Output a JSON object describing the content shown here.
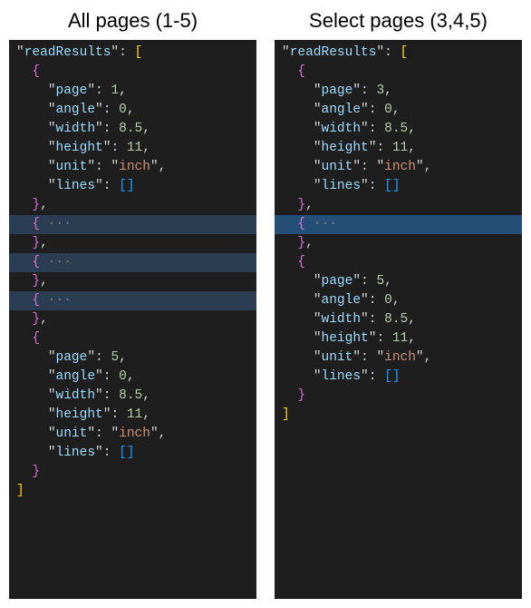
{
  "headings": {
    "left": "All pages (1-5)",
    "right": "Select pages (3,4,5)"
  },
  "json_field": {
    "readResults": "readResults",
    "page": "page",
    "angle": "angle",
    "width": "width",
    "height": "height",
    "unit": "unit",
    "lines": "lines"
  },
  "left_panel": {
    "first_page": {
      "page": "1",
      "angle": "0",
      "width": "8.5",
      "height": "11",
      "unit": "inch"
    },
    "last_page": {
      "page": "5",
      "angle": "0",
      "width": "8.5",
      "height": "11",
      "unit": "inch"
    },
    "folded_count": 3
  },
  "right_panel": {
    "first_page": {
      "page": "3",
      "angle": "0",
      "width": "8.5",
      "height": "11",
      "unit": "inch"
    },
    "last_page": {
      "page": "5",
      "angle": "0",
      "width": "8.5",
      "height": "11",
      "unit": "inch"
    },
    "folded_count": 1
  },
  "punct": {
    "quote": "\"",
    "colon": ":",
    "comma": ",",
    "open_sq": "[",
    "close_sq": "]",
    "open_br": "{",
    "close_br": "}",
    "dots": " ···"
  }
}
